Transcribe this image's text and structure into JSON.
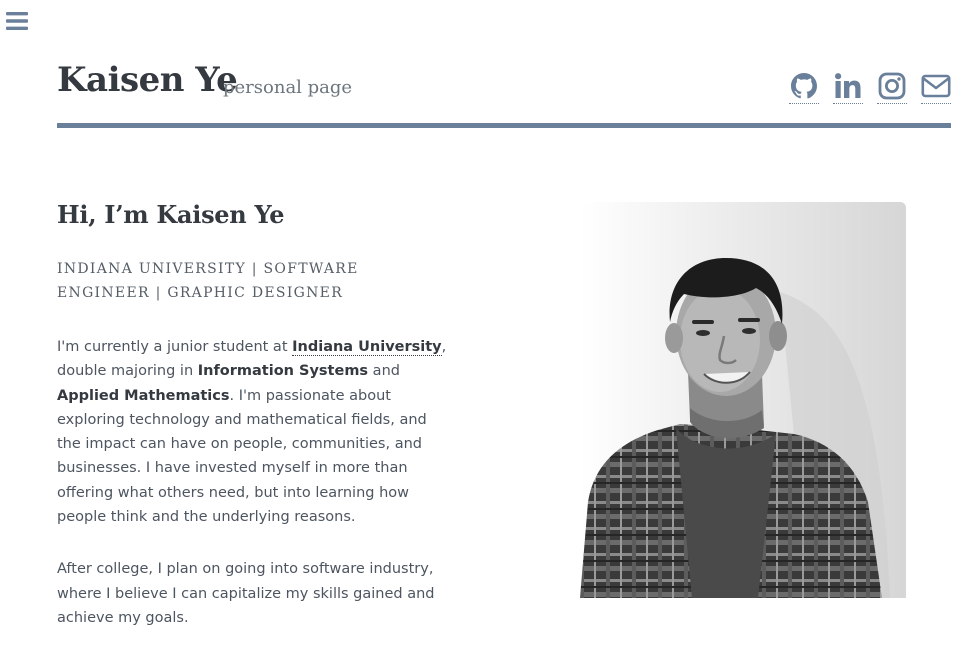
{
  "nav": {
    "menu_icon": "hamburger-menu-icon"
  },
  "header": {
    "title": "Kaisen Ye",
    "subtitle": "personal page",
    "social": [
      {
        "name": "github",
        "icon": "github-icon"
      },
      {
        "name": "linkedin",
        "icon": "linkedin-icon"
      },
      {
        "name": "instagram",
        "icon": "instagram-icon"
      },
      {
        "name": "email",
        "icon": "envelope-icon"
      }
    ]
  },
  "main": {
    "greeting": "Hi, I’m Kaisen Ye",
    "tagline": "INDIANA UNIVERSITY | SOFTWARE ENGINEER | GRAPHIC DESIGNER",
    "paragraph1": {
      "t1": "I'm currently a junior student at ",
      "link": "Indiana University",
      "t2": ", double majoring in ",
      "b1": "Information Systems",
      "t3": " and ",
      "b2": "Applied Mathematics",
      "t4": ". I'm passionate about exploring technology and mathematical fields, and the impact can have on people, communities, and businesses. I have invested myself in more than offering what others need, but into learning how people think and the underlying reasons."
    },
    "paragraph2": "After college, I plan on going into software industry, where I believe I can capitalize my skills gained and achieve my goals."
  },
  "colors": {
    "accent": "#6a7f9a",
    "heading": "#343a40",
    "text": "#4d5560"
  }
}
